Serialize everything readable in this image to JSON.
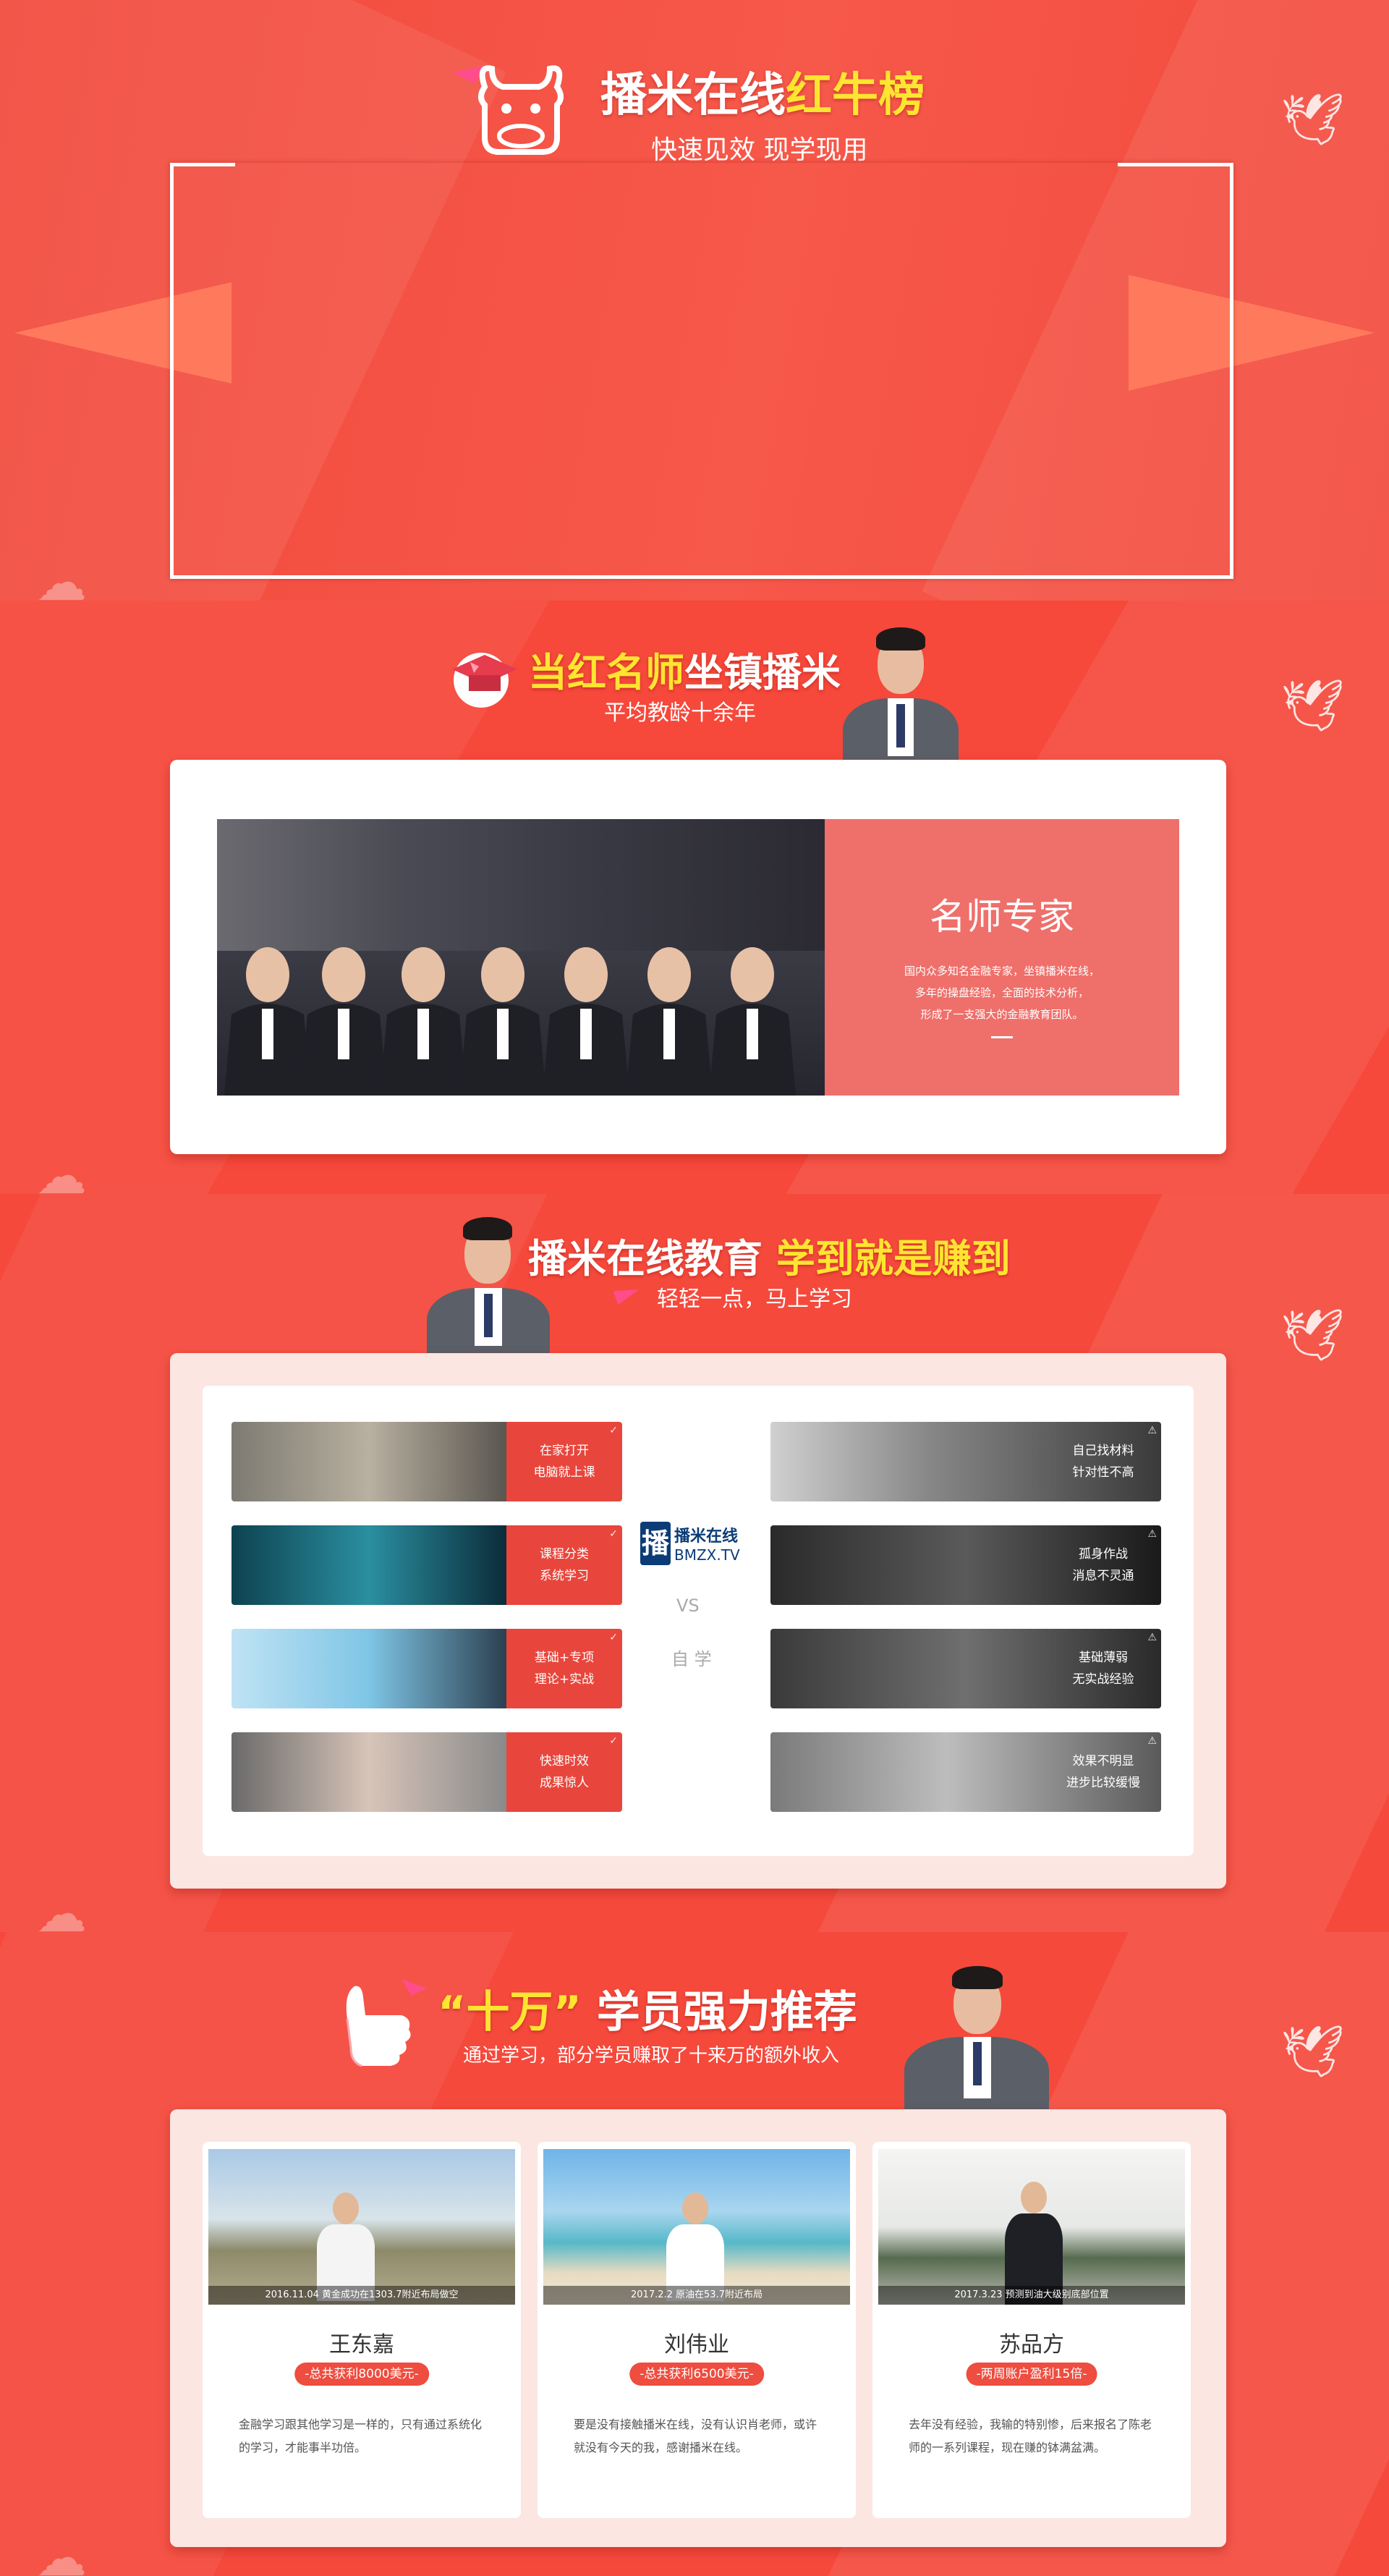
{
  "colors": {
    "brand_red": "#f5493c",
    "highlight_yellow": "#ffe431",
    "card_pink": "#fbe6e2",
    "badge_red": "#ee4d3f"
  },
  "hero": {
    "title_white": "播米在线",
    "title_highlight": "红牛榜",
    "subtitle": "快速见效 现学现用",
    "logo_icon": "bull-head-icon"
  },
  "teachers": {
    "title_highlight": "当红名师",
    "title_white": "坐镇播米",
    "subtitle": "平均教龄十余年",
    "panel_title": "名师专家",
    "panel_text": [
      "国内众多知名金融专家，坐镇播米在线，",
      "多年的操盘经验，全面的技术分析，",
      "形成了一支强大的金融教育团队。"
    ],
    "icon": "graduation-cap-icon"
  },
  "education": {
    "title_white": "播米在线教育",
    "title_highlight": "学到就是赚到",
    "subtitle": "轻轻一点，马上学习",
    "brand_cn": "播米在线",
    "brand_en": "BMZX.TV",
    "vs": "VS",
    "self_study": "自 学",
    "left_tiles": [
      {
        "lines": [
          "在家打开",
          "电脑就上课"
        ],
        "icon": "check-circle-icon"
      },
      {
        "lines": [
          "课程分类",
          "系统学习"
        ],
        "icon": "check-circle-icon"
      },
      {
        "lines": [
          "基础+专项",
          "理论+实战"
        ],
        "icon": "check-circle-icon"
      },
      {
        "lines": [
          "快速时效",
          "成果惊人"
        ],
        "icon": "check-circle-icon"
      }
    ],
    "right_tiles": [
      {
        "lines": [
          "自己找材料",
          "针对性不高"
        ],
        "icon": "warning-icon"
      },
      {
        "lines": [
          "孤身作战",
          "消息不灵通"
        ],
        "icon": "warning-icon"
      },
      {
        "lines": [
          "基础薄弱",
          "无实战经验"
        ],
        "icon": "warning-icon"
      },
      {
        "lines": [
          "效果不明显",
          "进步比较缓慢"
        ],
        "icon": "warning-icon"
      }
    ]
  },
  "testimonials": {
    "quote_open": "“",
    "title_highlight": "十万",
    "quote_close": "”",
    "title_white": "学员强力推荐",
    "subtitle": "通过学习，部分学员赚取了十来万的额外收入",
    "icon": "thumbs-up-icon",
    "cards": [
      {
        "caption": "2016.11.04 黄金成功在1303.7附近布局做空",
        "name": "王东嘉",
        "badge": "-总共获利8000美元-",
        "text": "金融学习跟其他学习是一样的，只有通过系统化的学习，才能事半功倍。"
      },
      {
        "caption": "2017.2.2 原油在53.7附近布局",
        "name": "刘伟业",
        "badge": "-总共获利6500美元-",
        "text": "要是没有接触播米在线，没有认识肖老师，或许就没有今天的我，感谢播米在线。"
      },
      {
        "caption": "2017.3.23 预测到油大级别底部位置",
        "name": "苏品方",
        "badge": "-两周账户盈利15倍-",
        "text": "去年没有经验，我输的特别惨，后来报名了陈老师的一系列课程，现在赚的钵满盆满。"
      }
    ]
  }
}
